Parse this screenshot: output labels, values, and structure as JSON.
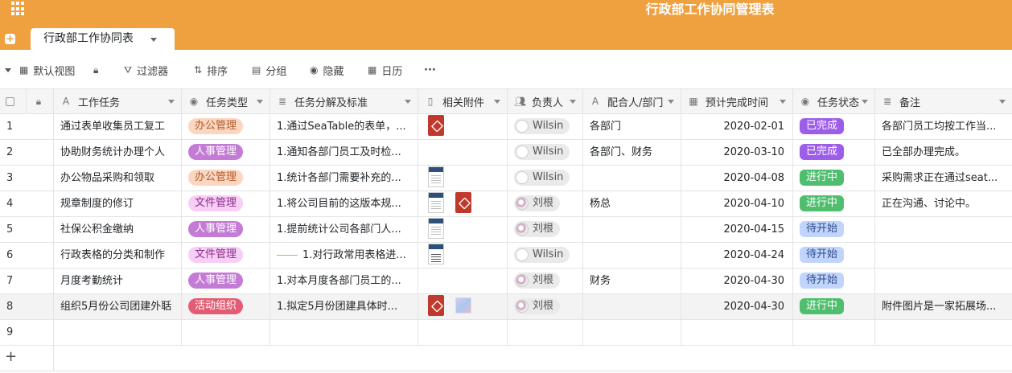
{
  "app": {
    "title": "行政部工作协同管理表"
  },
  "tab": {
    "label": "行政部工作协同表"
  },
  "toolbar": {
    "view": "默认视图",
    "filter": "过滤器",
    "sort": "排序",
    "group": "分组",
    "hide": "隐藏",
    "calendar": "日历",
    "more": "···"
  },
  "columns": [
    "工作任务",
    "任务类型",
    "任务分解及标准",
    "相关附件",
    "负责人",
    "配合人/部门",
    "预计完成时间",
    "任务状态",
    "备注"
  ],
  "rows": [
    {
      "n": "1",
      "task": "通过表单收集员工复工",
      "type": "办公管理",
      "detail": "1.通过SeaTable的表单，...",
      "files": [
        "pdf"
      ],
      "owner": "Wilsin",
      "partner": "各部门",
      "date": "2020-02-01",
      "status": "已完成",
      "note": "各部门员工均按工作当..."
    },
    {
      "n": "2",
      "task": "协助财务统计办理个人",
      "type": "人事管理",
      "detail": "1.通知各部门员工及时检...",
      "files": [],
      "owner": "Wilsin",
      "partner": "各部门、财务",
      "date": "2020-03-10",
      "status": "已完成",
      "note": "已全部办理完成。"
    },
    {
      "n": "3",
      "task": "办公物品采购和领取",
      "type": "办公管理",
      "detail": "1.统计各部门需要补充的...",
      "files": [
        "doc"
      ],
      "owner": "Wilsin",
      "partner": "",
      "date": "2020-04-08",
      "status": "进行中",
      "note": "采购需求正在通过seat..."
    },
    {
      "n": "4",
      "task": "规章制度的修订",
      "type": "文件管理",
      "detail": "1.将公司目前的这版本规...",
      "files": [
        "doc",
        "pdf"
      ],
      "owner": "刘根",
      "partner": "杨总",
      "date": "2020-04-10",
      "status": "进行中",
      "note": "正在沟通、讨论中。"
    },
    {
      "n": "5",
      "task": "社保公积金缴纳",
      "type": "人事管理",
      "detail": "1.提前统计公司各部门人...",
      "files": [
        "doc"
      ],
      "owner": "刘根",
      "partner": "",
      "date": "2020-04-15",
      "status": "待开始",
      "note": ""
    },
    {
      "n": "6",
      "task": "行政表格的分类和制作",
      "type": "文件管理",
      "detail": "1.对行政常用表格进...",
      "files": [
        "xls"
      ],
      "owner": "Wilsin",
      "partner": "",
      "date": "2020-04-24",
      "status": "待开始",
      "note": ""
    },
    {
      "n": "7",
      "task": "月度考勤统计",
      "type": "人事管理",
      "detail": "1.对本月度各部门员工的...",
      "files": [],
      "owner": "刘根",
      "partner": "财务",
      "date": "2020-04-30",
      "status": "待开始",
      "note": ""
    },
    {
      "n": "8",
      "task": "组织5月份公司团建外聒",
      "type": "活动组织",
      "detail": "1.拟定5月份团建具体时...",
      "files": [
        "pdf",
        "img"
      ],
      "owner": "刘根",
      "partner": "",
      "date": "2020-04-30",
      "status": "进行中",
      "note": "附件图片是一家拓展场..."
    },
    {
      "n": "9",
      "task": "",
      "type": "",
      "detail": "",
      "files": [],
      "owner": "",
      "partner": "",
      "date": "",
      "status": "",
      "note": ""
    }
  ],
  "add_row": "+",
  "colors": {
    "brand": "#efa03f",
    "type_办公管理": "#fbd7c2",
    "type_人事管理": "#c37bd6",
    "type_文件管理": "#f8cdf6",
    "type_活动组织": "#e45c73",
    "status_已完成": "#9c5de8",
    "status_进行中": "#4fbe6e",
    "status_待开始": "#c1d4fc"
  }
}
